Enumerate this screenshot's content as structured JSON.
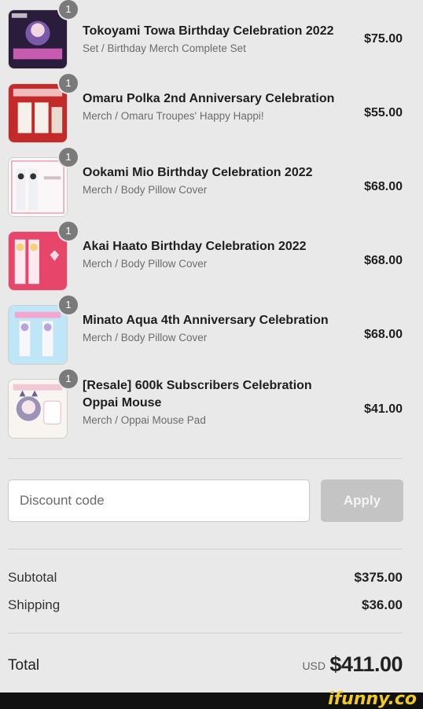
{
  "cart_items": [
    {
      "quantity": "1",
      "title": "Tokoyami Towa Birthday Celebration 2022",
      "subtitle": "Set / Birthday Merch Complete Set",
      "price": "$75.00"
    },
    {
      "quantity": "1",
      "title": "Omaru Polka 2nd Anniversary Celebration",
      "subtitle": "Merch / Omaru Troupes' Happy Happi!",
      "price": "$55.00"
    },
    {
      "quantity": "1",
      "title": "Ookami Mio Birthday Celebration 2022",
      "subtitle": "Merch / Body Pillow Cover",
      "price": "$68.00"
    },
    {
      "quantity": "1",
      "title": "Akai Haato Birthday Celebration 2022",
      "subtitle": "Merch / Body Pillow Cover",
      "price": "$68.00"
    },
    {
      "quantity": "1",
      "title": "Minato Aqua 4th Anniversary Celebration",
      "subtitle": "Merch / Body Pillow Cover",
      "price": "$68.00"
    },
    {
      "quantity": "1",
      "title": "[Resale] 600k Subscribers Celebration Oppai Mouse",
      "subtitle": "Merch / Oppai Mouse Pad",
      "price": "$41.00"
    }
  ],
  "discount": {
    "placeholder": "Discount code",
    "apply_label": "Apply"
  },
  "summary": {
    "subtotal_label": "Subtotal",
    "subtotal_value": "$375.00",
    "shipping_label": "Shipping",
    "shipping_value": "$36.00"
  },
  "total": {
    "label": "Total",
    "currency": "USD",
    "value": "$411.00"
  },
  "watermark": "ifunny.co",
  "colors": {
    "background": "#e9e9ea",
    "apply_button": "#c4c4c4",
    "qty_badge": "#7a7a7a",
    "watermark": "#f2cc1c"
  }
}
